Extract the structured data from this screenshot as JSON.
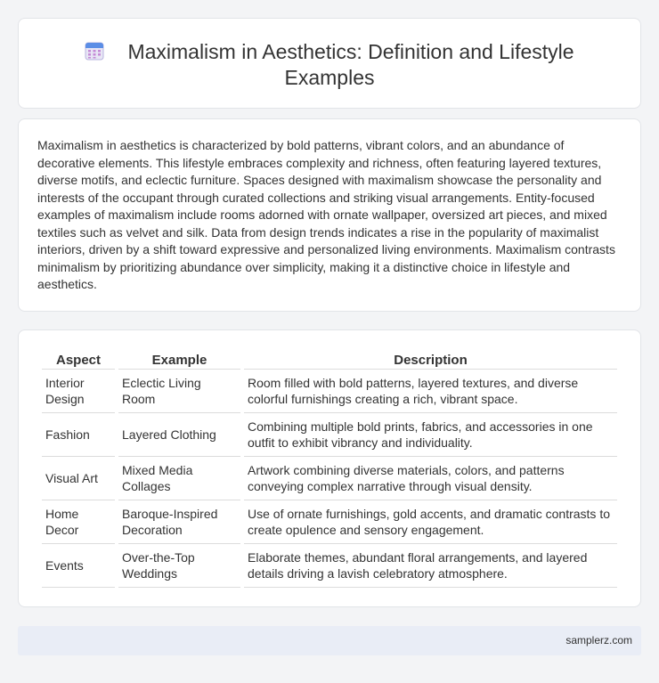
{
  "header": {
    "title_line1": "Maximalism in Aesthetics: Definition and Lifestyle",
    "title_line2": "Examples",
    "icon": "calendar-icon"
  },
  "intro": {
    "text": "Maximalism in aesthetics is characterized by bold patterns, vibrant colors, and an abundance of decorative elements. This lifestyle embraces complexity and richness, often featuring layered textures, diverse motifs, and eclectic furniture. Spaces designed with maximalism showcase the personality and interests of the occupant through curated collections and striking visual arrangements. Entity-focused examples of maximalism include rooms adorned with ornate wallpaper, oversized art pieces, and mixed textiles such as velvet and silk. Data from design trends indicates a rise in the popularity of maximalist interiors, driven by a shift toward expressive and personalized living environments. Maximalism contrasts minimalism by prioritizing abundance over simplicity, making it a distinctive choice in lifestyle and aesthetics."
  },
  "table": {
    "headers": [
      "Aspect",
      "Example",
      "Description"
    ],
    "rows": [
      {
        "aspect": "Interior Design",
        "example": "Eclectic Living Room",
        "description": "Room filled with bold patterns, layered textures, and diverse colorful furnishings creating a rich, vibrant space."
      },
      {
        "aspect": "Fashion",
        "example": "Layered Clothing",
        "description": "Combining multiple bold prints, fabrics, and accessories in one outfit to exhibit vibrancy and individuality."
      },
      {
        "aspect": "Visual Art",
        "example": "Mixed Media Collages",
        "description": "Artwork combining diverse materials, colors, and patterns conveying complex narrative through visual density."
      },
      {
        "aspect": "Home Decor",
        "example": "Baroque-Inspired Decoration",
        "description": "Use of ornate furnishings, gold accents, and dramatic contrasts to create opulence and sensory engagement."
      },
      {
        "aspect": "Events",
        "example": "Over-the-Top Weddings",
        "description": "Elaborate themes, abundant floral arrangements, and layered details driving a lavish celebratory atmosphere."
      }
    ]
  },
  "footer": {
    "site": "samplerz.com"
  }
}
